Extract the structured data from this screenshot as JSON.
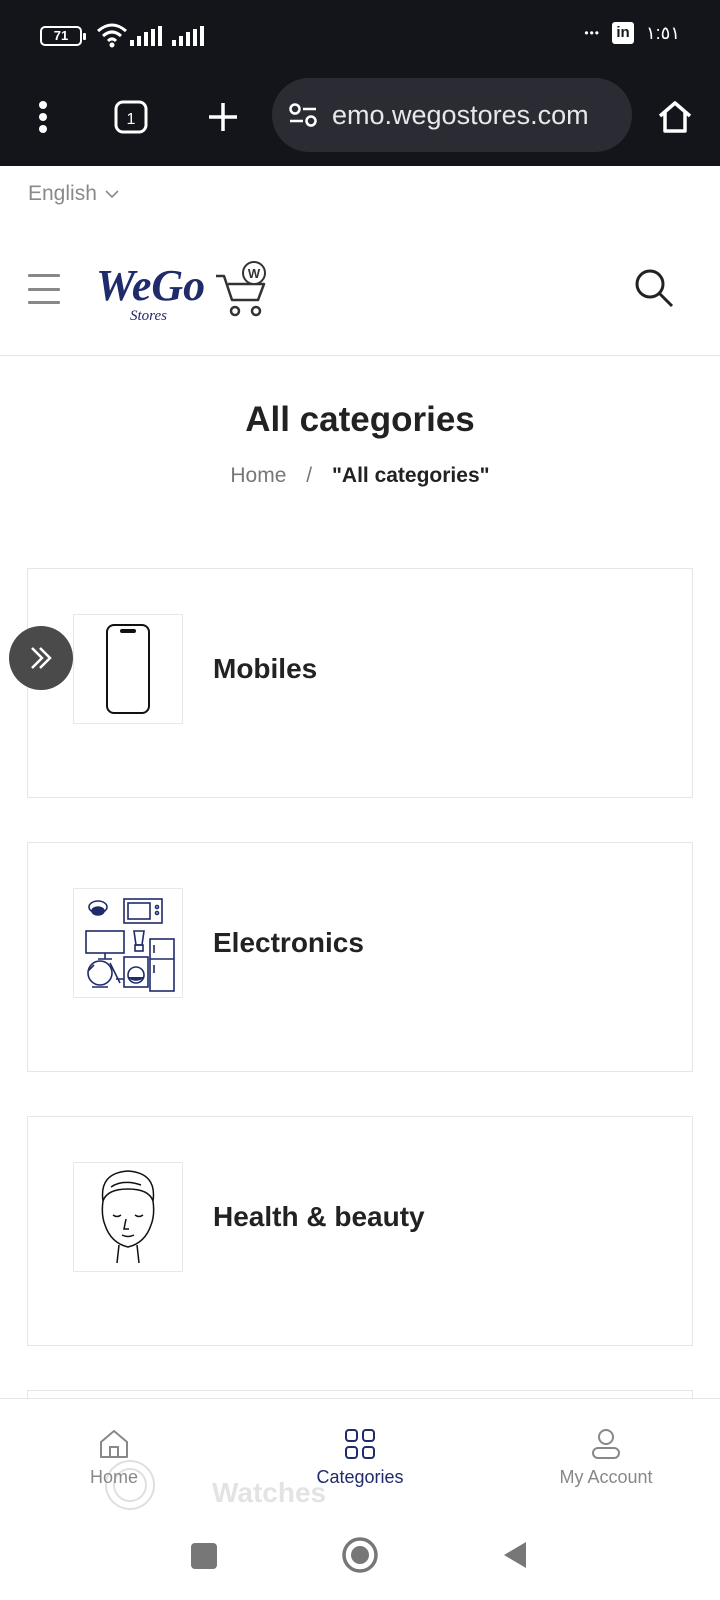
{
  "status_bar": {
    "battery": "71",
    "time": "١:٥١",
    "dots": "•••",
    "linkedin": "in"
  },
  "browser": {
    "url": "emo.wegostores.com"
  },
  "language": {
    "label": "English"
  },
  "logo": {
    "text": "WeGo",
    "sub": "Stores",
    "badge": "W"
  },
  "page": {
    "title": "All categories"
  },
  "breadcrumb": {
    "home": "Home",
    "separator": "/",
    "current": "\"All categories\""
  },
  "categories": [
    {
      "name": "Mobiles",
      "icon": "mobile-phone-icon"
    },
    {
      "name": "Electronics",
      "icon": "electronics-icon"
    },
    {
      "name": "Health & beauty",
      "icon": "face-towel-icon"
    },
    {
      "name": "Watches",
      "icon": "watch-icon"
    }
  ],
  "bottom_nav": {
    "home": "Home",
    "categories": "Categories",
    "account": "My Account",
    "active": "categories"
  },
  "colors": {
    "brand": "#1f2b6b",
    "dark_bar": "#14151a",
    "url_pill": "#2b2c33"
  }
}
